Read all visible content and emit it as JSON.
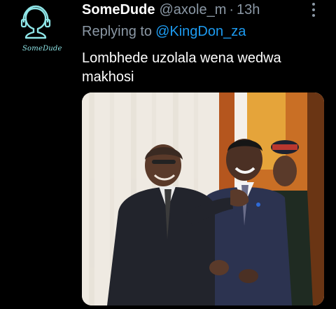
{
  "avatar": {
    "caption": "SomeDude",
    "icon": "person-outline-avatar"
  },
  "tweet": {
    "display_name": "SomeDude",
    "handle": "@axole_m",
    "separator": "·",
    "time": "13h",
    "replying_prefix": "Replying to",
    "replying_to": "@KingDon_za",
    "text": "Lombhede uzolala wena wedwa makhosi",
    "more_icon": "vertical-ellipsis-icon"
  },
  "media": {
    "kind": "photo"
  },
  "colors": {
    "background": "#000000",
    "primary_text": "#ffffff",
    "secondary_text": "#8b98a5",
    "link": "#1d9bf0",
    "avatar_accent": "#8fe6e8"
  }
}
